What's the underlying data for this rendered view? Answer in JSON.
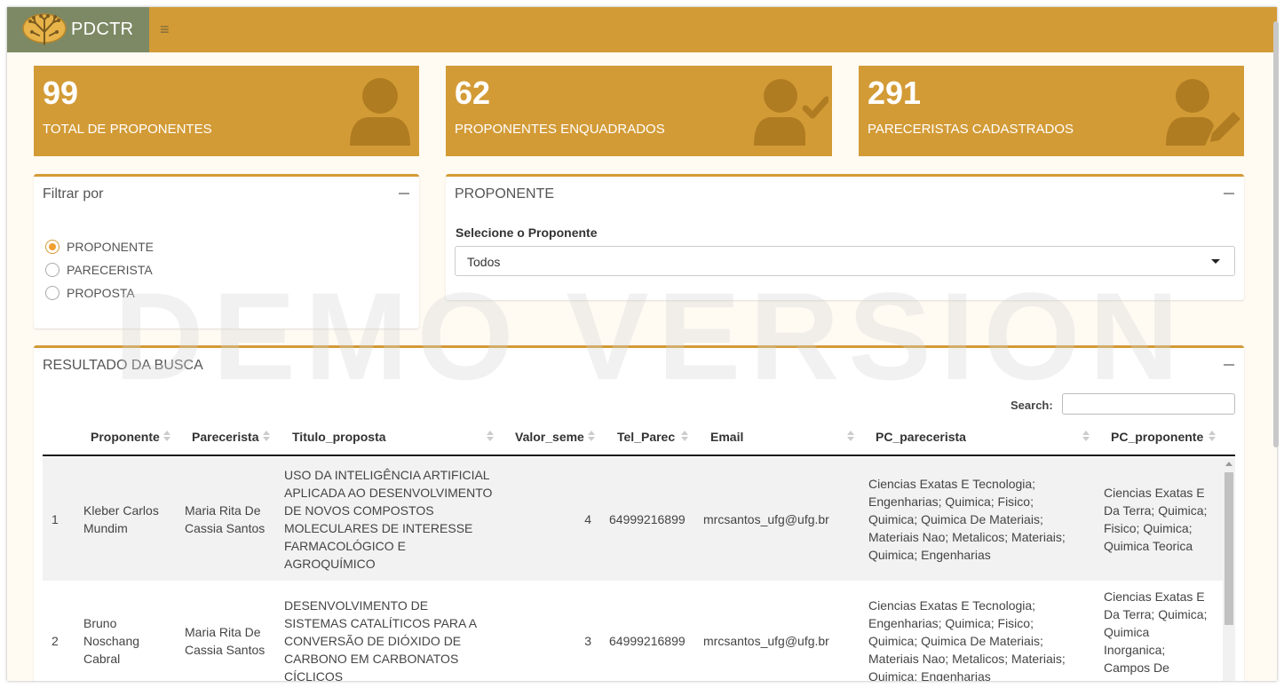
{
  "app": {
    "brand": "PDCTR"
  },
  "navbar": {
    "menu_icon": "hamburger-icon",
    "menu_glyph": "≡"
  },
  "stats": [
    {
      "value": "99",
      "label": "TOTAL DE PROPONENTES",
      "icon": "user-icon"
    },
    {
      "value": "62",
      "label": "PROPONENTES ENQUADRADOS",
      "icon": "user-check-icon"
    },
    {
      "value": "291",
      "label": "PARECERISTAS CADASTRADOS",
      "icon": "user-edit-icon"
    }
  ],
  "filter": {
    "title": "Filtrar por",
    "options": [
      {
        "label": "PROPONENTE",
        "checked": true
      },
      {
        "label": "PARECERISTA",
        "checked": false
      },
      {
        "label": "PROPOSTA",
        "checked": false
      }
    ]
  },
  "proponente_box": {
    "title": "PROPONENTE",
    "select_label": "Selecione o Proponente",
    "select_value": "Todos"
  },
  "results": {
    "title": "RESULTADO DA BUSCA",
    "search_label": "Search:",
    "columns": [
      "Proponente",
      "Parecerista",
      "Titulo_proposta",
      "Valor_seme",
      "Tel_Parec",
      "Email",
      "PC_parecerista",
      "PC_proponente"
    ],
    "rows": [
      {
        "index": "1",
        "proponente": "Kleber Carlos Mundim",
        "parecerista": "Maria Rita De Cassia Santos",
        "titulo": "USO DA INTELIGÊNCIA ARTIFICIAL APLICADA AO DESENVOLVIMENTO DE NOVOS COMPOSTOS MOLECULARES DE INTERESSE FARMACOLÓGICO E AGROQUÍMICO",
        "valor": "4",
        "tel": "64999216899",
        "email": "mrcsantos_ufg@ufg.br",
        "pc_parecerista": "Ciencias Exatas E Tecnologia; Engenharias; Quimica; Fisico; Quimica; Quimica De Materiais; Materiais Nao; Metalicos; Materiais; Quimica; Engenharias",
        "pc_proponente": "Ciencias Exatas E Da Terra; Quimica; Fisico; Quimica; Quimica Teorica"
      },
      {
        "index": "2",
        "proponente": "Bruno Noschang Cabral",
        "parecerista": "Maria Rita De Cassia Santos",
        "titulo": "DESENVOLVIMENTO DE SISTEMAS CATALÍTICOS PARA A CONVERSÃO DE DIÓXIDO DE CARBONO EM CARBONATOS CÍCLICOS",
        "valor": "3",
        "tel": "64999216899",
        "email": "mrcsantos_ufg@ufg.br",
        "pc_parecerista": "Ciencias Exatas E Tecnologia; Engenharias; Quimica; Fisico; Quimica; Quimica De Materiais; Materiais Nao; Metalicos; Materiais; Quimica; Engenharias",
        "pc_proponente": "Ciencias Exatas E Da Terra; Quimica; Quimica Inorganica; Campos De Coordenacao"
      }
    ]
  },
  "watermark": "DEMO VERSION",
  "colors": {
    "accent": "#d39b36",
    "brand_bg": "#7d8964",
    "icon_shade": "#b07c22"
  }
}
